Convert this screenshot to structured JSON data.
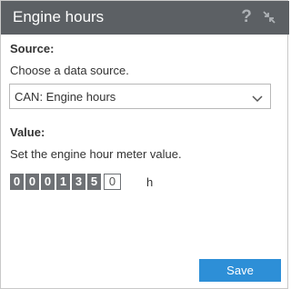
{
  "window": {
    "title": "Engine hours"
  },
  "source": {
    "heading": "Source:",
    "hint": "Choose a data source.",
    "selected": "CAN: Engine hours"
  },
  "value": {
    "heading": "Value:",
    "hint": "Set the engine hour meter value.",
    "digits": [
      "0",
      "0",
      "0",
      "1",
      "3",
      "5"
    ],
    "fraction_digit": "0",
    "unit": "h"
  },
  "actions": {
    "save_label": "Save"
  },
  "colors": {
    "titlebar": "#5c6064",
    "accent": "#2d8fd7",
    "digit_bg": "#6e7175"
  },
  "icons": {
    "help": "help-icon",
    "expand": "collapse-arrows-icon",
    "dropdown": "chevron-down-icon"
  }
}
